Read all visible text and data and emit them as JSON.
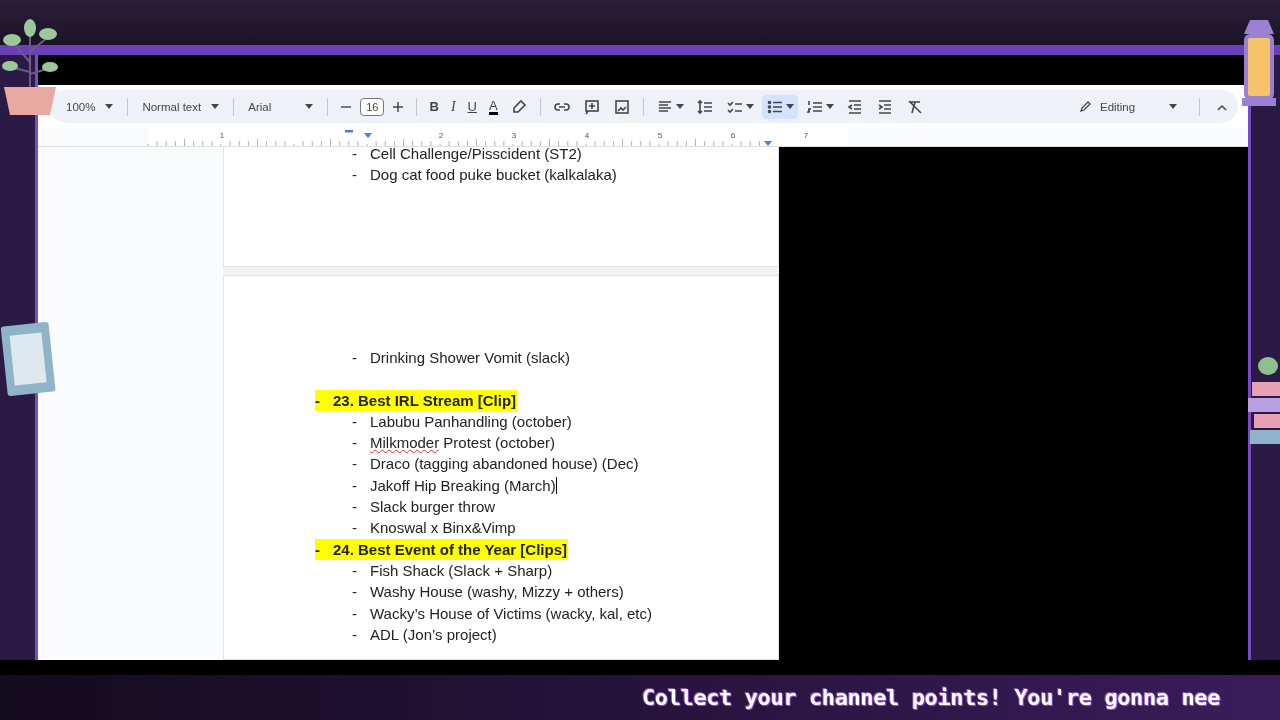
{
  "toolbar": {
    "zoom": "100%",
    "style": "Normal text",
    "font": "Arial",
    "font_size": "16",
    "tool_groups": [
      [
        {
          "kind": "bold",
          "label": "B",
          "selected": false,
          "has_menu": false
        },
        {
          "kind": "italic",
          "label": "I",
          "selected": false,
          "has_menu": false
        },
        {
          "kind": "underline",
          "label": "U",
          "selected": false,
          "has_menu": false
        },
        {
          "kind": "text-color",
          "label": "A",
          "selected": false,
          "has_menu": false
        },
        {
          "kind": "highlight",
          "selected": false,
          "has_menu": false
        }
      ],
      [
        {
          "kind": "link",
          "selected": false,
          "has_menu": false
        },
        {
          "kind": "comment",
          "selected": false,
          "has_menu": false
        },
        {
          "kind": "image",
          "selected": false,
          "has_menu": false
        }
      ],
      [
        {
          "kind": "align",
          "selected": false,
          "has_menu": true
        },
        {
          "kind": "line-spacing",
          "selected": false,
          "has_menu": false
        },
        {
          "kind": "checklist",
          "selected": false,
          "has_menu": true
        },
        {
          "kind": "bullet-list",
          "selected": true,
          "has_menu": true
        },
        {
          "kind": "numbered-list",
          "selected": false,
          "has_menu": true
        },
        {
          "kind": "outdent",
          "selected": false,
          "has_menu": false
        },
        {
          "kind": "indent",
          "selected": false,
          "has_menu": false
        },
        {
          "kind": "clear-format",
          "selected": false,
          "has_menu": false
        }
      ]
    ],
    "mode": "Editing"
  },
  "ruler": [
    "1",
    "2",
    "3",
    "4",
    "5",
    "6",
    "7"
  ],
  "pages": [
    {
      "lines": [
        {
          "kind": "item",
          "bullet": "-",
          "text": "Cell Challenge/Pisscident (ST2)",
          "blank_line_after": false,
          "cursor": false
        },
        {
          "kind": "item",
          "bullet": "-",
          "text": "Dog cat food puke bucket (kalkalaka)",
          "blank_line_after": false,
          "cursor": false
        }
      ]
    },
    {
      "lines": [
        {
          "kind": "item",
          "bullet": "-",
          "text": "Drinking Shower Vomit (slack)",
          "blank_line_after": true,
          "cursor": false
        },
        {
          "kind": "heading",
          "bullet": "-",
          "text": "23. Best IRL Stream [Clip]",
          "cursor": false
        },
        {
          "kind": "item",
          "bullet": "-",
          "text": "Labubu Panhandling (october)",
          "blank_line_after": false,
          "cursor": false
        },
        {
          "kind": "item",
          "bullet": "-",
          "parts": [
            {
              "text": "Milkmoder",
              "misspelled": true
            },
            {
              "text": " Protest (october)",
              "misspelled": false
            }
          ],
          "blank_line_after": false,
          "cursor": false
        },
        {
          "kind": "item",
          "bullet": "-",
          "text": "Draco (tagging abandoned house) (Dec)",
          "blank_line_after": false,
          "cursor": false
        },
        {
          "kind": "item",
          "bullet": "-",
          "text": "Jakoff Hip Breaking (March)",
          "blank_line_after": false,
          "cursor": true
        },
        {
          "kind": "item",
          "bullet": "-",
          "text": "Slack burger throw",
          "blank_line_after": false,
          "cursor": false
        },
        {
          "kind": "item",
          "bullet": "-",
          "text": "Knoswal x Binx&Vimp",
          "blank_line_after": false,
          "cursor": false
        },
        {
          "kind": "heading",
          "bullet": "-",
          "text": "24. Best Event of the Year [Clips]",
          "cursor": false
        },
        {
          "kind": "item",
          "bullet": "-",
          "text": "Fish Shack (Slack + Sharp)",
          "blank_line_after": false,
          "cursor": false
        },
        {
          "kind": "item",
          "bullet": "-",
          "text": "Washy House (washy, Mizzy + others)",
          "blank_line_after": false,
          "cursor": false
        },
        {
          "kind": "item",
          "bullet": "-",
          "text": "Wacky’s House of Victims (wacky, kal, etc)",
          "blank_line_after": false,
          "cursor": false
        },
        {
          "kind": "item",
          "bullet": "-",
          "text": "ADL (Jon’s project)",
          "blank_line_after": false,
          "cursor": false
        }
      ]
    }
  ],
  "ticker": "Collect your channel points! You're gonna nee"
}
